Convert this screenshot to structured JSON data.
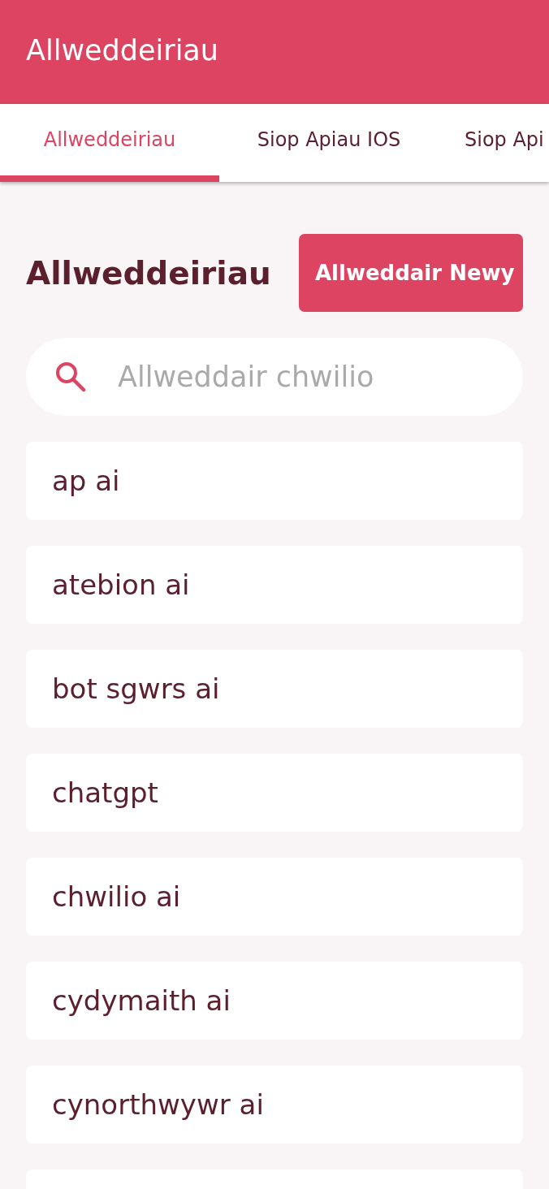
{
  "app_bar": {
    "title": "Allweddeiriau"
  },
  "tabs": [
    {
      "label": "Allweddeiriau",
      "selected": true
    },
    {
      "label": "Siop Apiau IOS",
      "selected": false
    },
    {
      "label": "Siop Api",
      "selected": false
    }
  ],
  "header": {
    "title": "Allweddeiriau",
    "button": "Allweddair Newy"
  },
  "search": {
    "placeholder": "Allweddair chwilio"
  },
  "keywords": [
    {
      "kind": "keyword",
      "label": "ap ai"
    },
    {
      "kind": "keyword",
      "label": "atebion ai"
    },
    {
      "kind": "keyword",
      "label": "bot sgwrs ai"
    },
    {
      "kind": "keyword",
      "label": "chatgpt"
    },
    {
      "kind": "keyword",
      "label": "chwilio ai"
    },
    {
      "kind": "keyword",
      "label": "cydymaith ai"
    },
    {
      "kind": "keyword",
      "label": "cynorthwywr ai"
    },
    {
      "kind": "cut-off"
    }
  ]
}
